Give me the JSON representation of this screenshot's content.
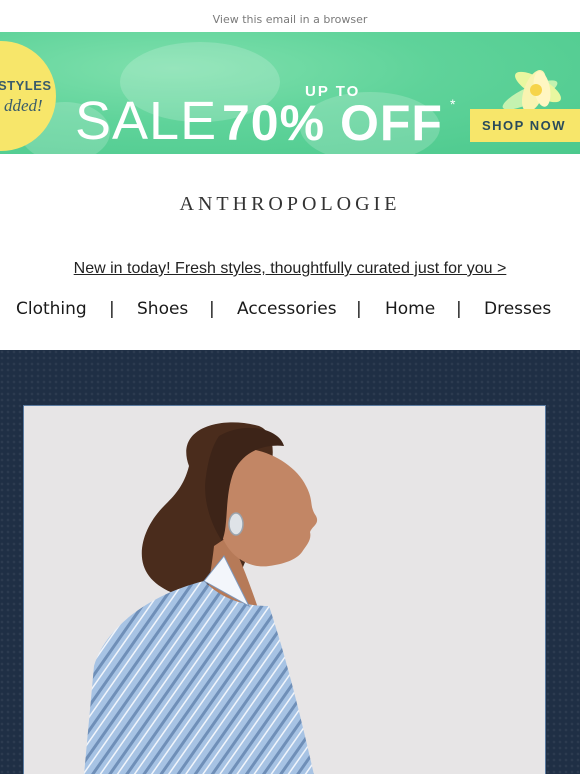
{
  "top_link": {
    "label": "View this email in a browser"
  },
  "banner": {
    "badge_line1": "STYLES",
    "badge_line2": "dded!",
    "sale_word": "SALE",
    "up_to": "UP TO",
    "percent": "70% OFF",
    "asterisk": "*",
    "cta": "SHOP NOW",
    "colors": {
      "background": "#5fd39a",
      "badge": "#f7e66a",
      "text": "#ffffff",
      "cta_text": "#2a4b5b"
    }
  },
  "brand": {
    "logo": "ANTHROPOLOGIE"
  },
  "promo": {
    "link": "New in today! Fresh styles, thoughtfully curated just for you >"
  },
  "nav": {
    "items": [
      "Clothing",
      "Shoes",
      "Accessories",
      "Home",
      "Dresses"
    ],
    "separator": "|"
  },
  "hero": {
    "colors": {
      "background": "#1f2f45",
      "photo_backdrop": "#e7e5e6",
      "shirt": "#9dbbe0"
    }
  }
}
